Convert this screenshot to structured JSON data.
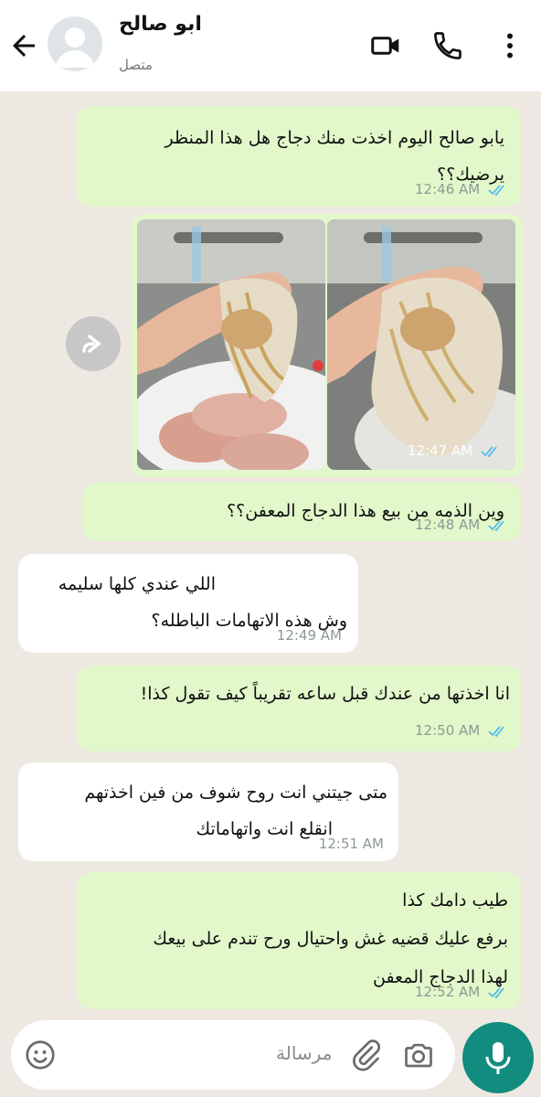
{
  "header": {
    "contact_name": "ابو صالح",
    "status": "متصل",
    "back_icon": "arrow-left-icon",
    "video_icon": "video-call-icon",
    "call_icon": "phone-icon",
    "menu_icon": "more-vert-icon"
  },
  "messages": [
    {
      "dir": "out",
      "lines": [
        "يابو صالح اليوم اخذت منك دجاج هل هذا المنظر",
        "يرضيك؟؟"
      ],
      "time": "12:46 AM",
      "read": true
    },
    {
      "dir": "out",
      "type": "images",
      "count": 2,
      "time": "12:47 AM",
      "read": true
    },
    {
      "dir": "out",
      "lines": [
        "وين الذمه من بيع هذا الدجاج المعفن؟؟"
      ],
      "time": "12:48 AM",
      "read": true
    },
    {
      "dir": "in",
      "lines": [
        "اللي عندي كلها سليمه",
        "وش هذه الاتهامات الباطله؟"
      ],
      "time": "12:49 AM"
    },
    {
      "dir": "out",
      "lines": [
        "انا اخذتها من عندك قبل ساعه تقريباً كيف تقول كذا!"
      ],
      "time": "12:50 AM",
      "read": true
    },
    {
      "dir": "in",
      "lines": [
        "متى جيتني انت روح شوف من فين اخذتهم",
        "انقلع انت واتهاماتك"
      ],
      "time": "12:51 AM"
    },
    {
      "dir": "out",
      "lines": [
        "طيب دامك كذا",
        "برفع عليك قضيه غش واحتيال ورح تندم على بيعك",
        "لهذا الدجاج المعفن"
      ],
      "time": "12:52 AM",
      "read": true
    }
  ],
  "input": {
    "placeholder": "مرسالة",
    "emoji_icon": "emoji-icon",
    "attach_icon": "paperclip-icon",
    "camera_icon": "camera-icon",
    "mic_icon": "microphone-icon"
  },
  "colors": {
    "outgoing_bubble": "#E2F8CB",
    "incoming_bubble": "#FFFFFF",
    "read_ticks": "#53BDEB",
    "accent": "#128C7E"
  }
}
